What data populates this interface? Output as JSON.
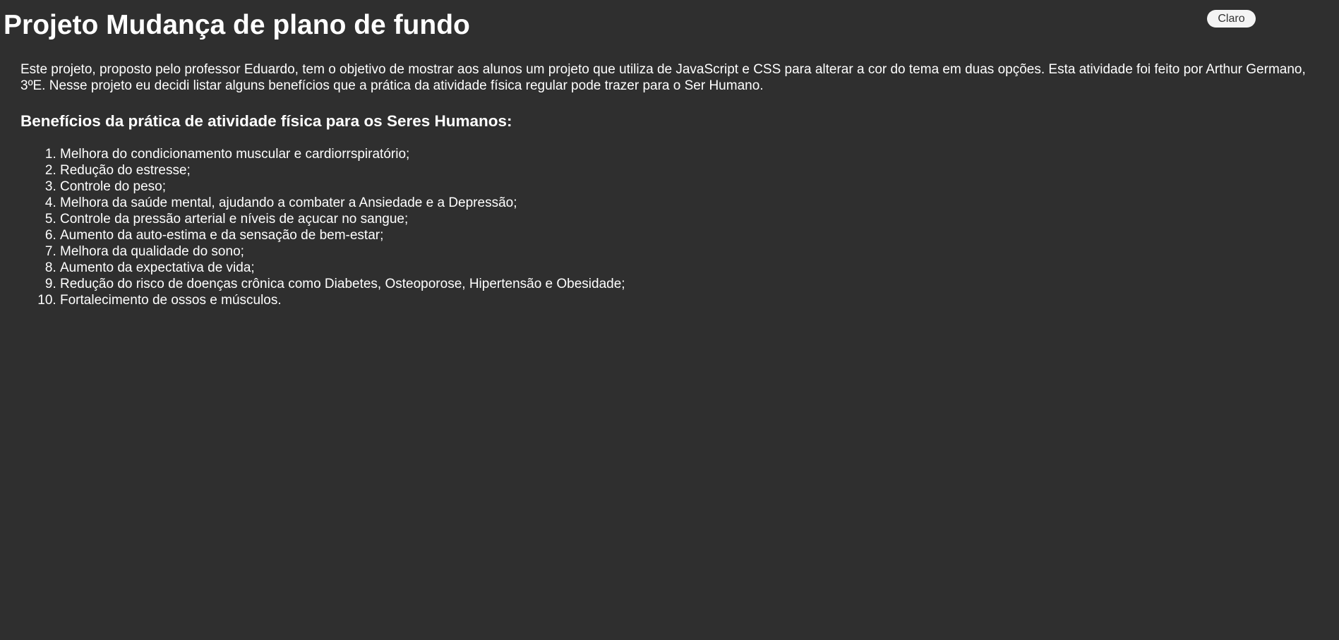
{
  "header": {
    "title": "Projeto Mudança de plano de fundo",
    "theme_button_label": "Claro"
  },
  "main": {
    "intro": "Este projeto, proposto pelo professor Eduardo, tem o objetivo de mostrar aos alunos um projeto que utiliza de JavaScript e CSS para alterar a cor do tema em duas opções. Esta atividade foi feito por Arthur Germano, 3ºE. Nesse projeto eu decidi listar alguns benefícios que a prática da atividade física regular pode trazer para o Ser Humano.",
    "benefits_heading": "Benefícios da prática de atividade física para os Seres Humanos:",
    "benefits": [
      "Melhora do condicionamento muscular e cardiorrspiratório;",
      "Redução do estresse;",
      "Controle do peso;",
      "Melhora da saúde mental, ajudando a combater a Ansiedade e a Depressão;",
      "Controle da pressão arterial e níveis de açucar no sangue;",
      "Aumento da auto-estima e da sensação de bem-estar;",
      "Melhora da qualidade do sono;",
      "Aumento da expectativa de vida;",
      "Redução do risco de doenças crônica como Diabetes, Osteoporose, Hipertensão e Obesidade;",
      "Fortalecimento de ossos e músculos."
    ]
  },
  "colors": {
    "background": "#2f2f2f",
    "text": "#ffffff",
    "button_background": "#f4f4f4",
    "button_text": "#333333"
  }
}
